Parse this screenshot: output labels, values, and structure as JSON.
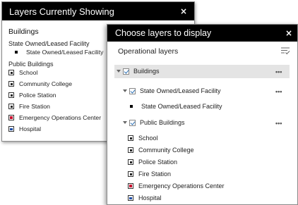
{
  "legend_panel": {
    "title": "Layers Currently Showing",
    "close_label": "×",
    "group_title": "Buildings",
    "subgroup_state": "State Owned/Leased Facility",
    "state_item": "State Owned/Leased Facility",
    "subgroup_public": "Public Buildings",
    "public_items": [
      "School",
      "Community College",
      "Police Station",
      "Fire Station",
      "Emergency Operations Center",
      "Hospital"
    ]
  },
  "layer_panel": {
    "title": "Choose layers to display",
    "close_label": "×",
    "section_header": "Operational layers",
    "layers": {
      "buildings": "Buildings",
      "state_owned": "State Owned/Leased Facility",
      "state_item": "State Owned/Leased Facility",
      "public_buildings": "Public Buildings",
      "public_items": [
        "School",
        "Community College",
        "Police Station",
        "Fire Station",
        "Emergency Operations Center",
        "Hospital"
      ]
    },
    "options_label": "•••"
  },
  "colors": {
    "titlebar": "#000000",
    "check": "#2a6fb5",
    "emergency_symbol": "#c8102e",
    "hospital_symbol": "#1f4fa8"
  }
}
